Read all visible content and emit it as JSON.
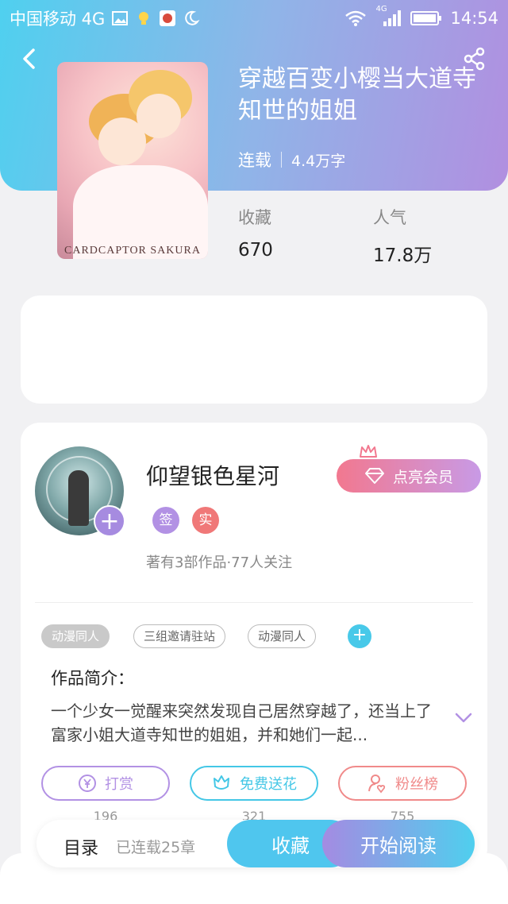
{
  "status_bar": {
    "carrier": "中国移动 4G",
    "network": "4G",
    "time": "14:54"
  },
  "book": {
    "title": "穿越百变小樱当大道寺知世的姐姐",
    "status": "连载",
    "word_count": "4.4万字",
    "cover_caption": "CARDCAPTOR SAKURA"
  },
  "stats": {
    "collect_label": "收藏",
    "collect_value": "670",
    "popularity_label": "人气",
    "popularity_value": "17.8万"
  },
  "author": {
    "name": "仰望银色星河",
    "badge_sign": "签",
    "badge_real": "实",
    "summary": "著有3部作品·77人关注",
    "vip_button": "点亮会员"
  },
  "tags": [
    "动漫同人",
    "三组邀请驻站",
    "动漫同人"
  ],
  "intro": {
    "title": "作品简介：",
    "text": "一个少女一觉醒来突然发现自己居然穿越了，还当上了富家小姐大道寺知世的姐姐，并和她们一起..."
  },
  "actions": [
    {
      "label": "打赏",
      "count": "196",
      "color": "#b291e4"
    },
    {
      "label": "免费送花",
      "count": "321",
      "color": "#44c7e6"
    },
    {
      "label": "粉丝榜",
      "count": "755",
      "color": "#f08a8a"
    }
  ],
  "bottom_bar": {
    "toc": "目录",
    "chapters": "已连载25章",
    "favorite": "收藏",
    "read": "开始阅读"
  },
  "colors": {
    "hero_start": "#4fd0ef",
    "hero_end": "#b18fe0",
    "accent_blue": "#4fc6ee",
    "accent_purple": "#a48be2",
    "vip_pink": "#f2788f"
  }
}
